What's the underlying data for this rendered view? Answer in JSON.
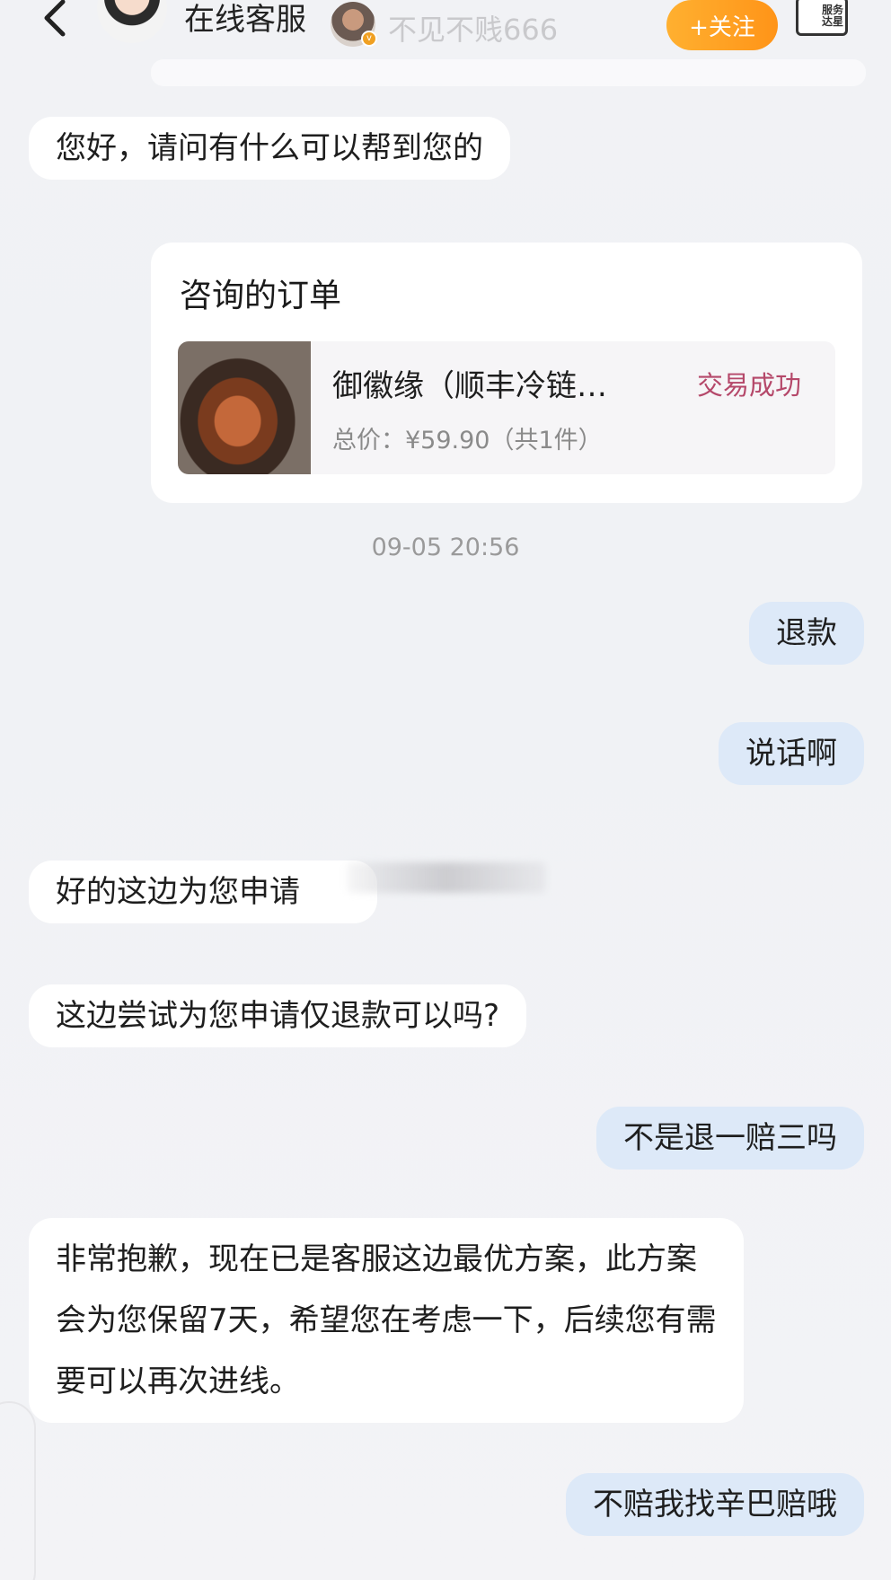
{
  "header": {
    "agent_name": "在线客服",
    "shop_name": "不见不贱666",
    "shop_badge": "v",
    "follow_label": "+关注",
    "service_label": "服务\n达星"
  },
  "messages": [
    {
      "side": "in",
      "text": "您好，请问有什么可以帮到您的"
    },
    {
      "side": "out",
      "text": "退款"
    },
    {
      "side": "out",
      "text": "说话啊"
    },
    {
      "side": "in",
      "text": "好的这边为您申请"
    },
    {
      "side": "in",
      "text": "这边尝试为您申请仅退款可以吗?"
    },
    {
      "side": "out",
      "text": "不是退一赔三吗"
    },
    {
      "side": "in",
      "text": "非常抱歉，现在已是客服这边最优方案，此方案会为您保留7天，希望您在考虑一下，后续您有需要可以再次进线。"
    },
    {
      "side": "out",
      "text": "不赔我找辛巴赔哦"
    }
  ],
  "order_card": {
    "title": "咨询的订单",
    "product_name": "御徽缘（顺丰冷链…",
    "status": "交易成功",
    "price_text": "总价：¥59.90（共1件）"
  },
  "timestamp": "09-05 20:56",
  "colors": {
    "incoming_bubble": "#ffffff",
    "outgoing_bubble": "#dde9f8",
    "follow_button": "#ff9f22",
    "status_text": "#b5486a"
  },
  "icons": {
    "back": "back-chevron-icon",
    "service": "service-badge-icon"
  }
}
